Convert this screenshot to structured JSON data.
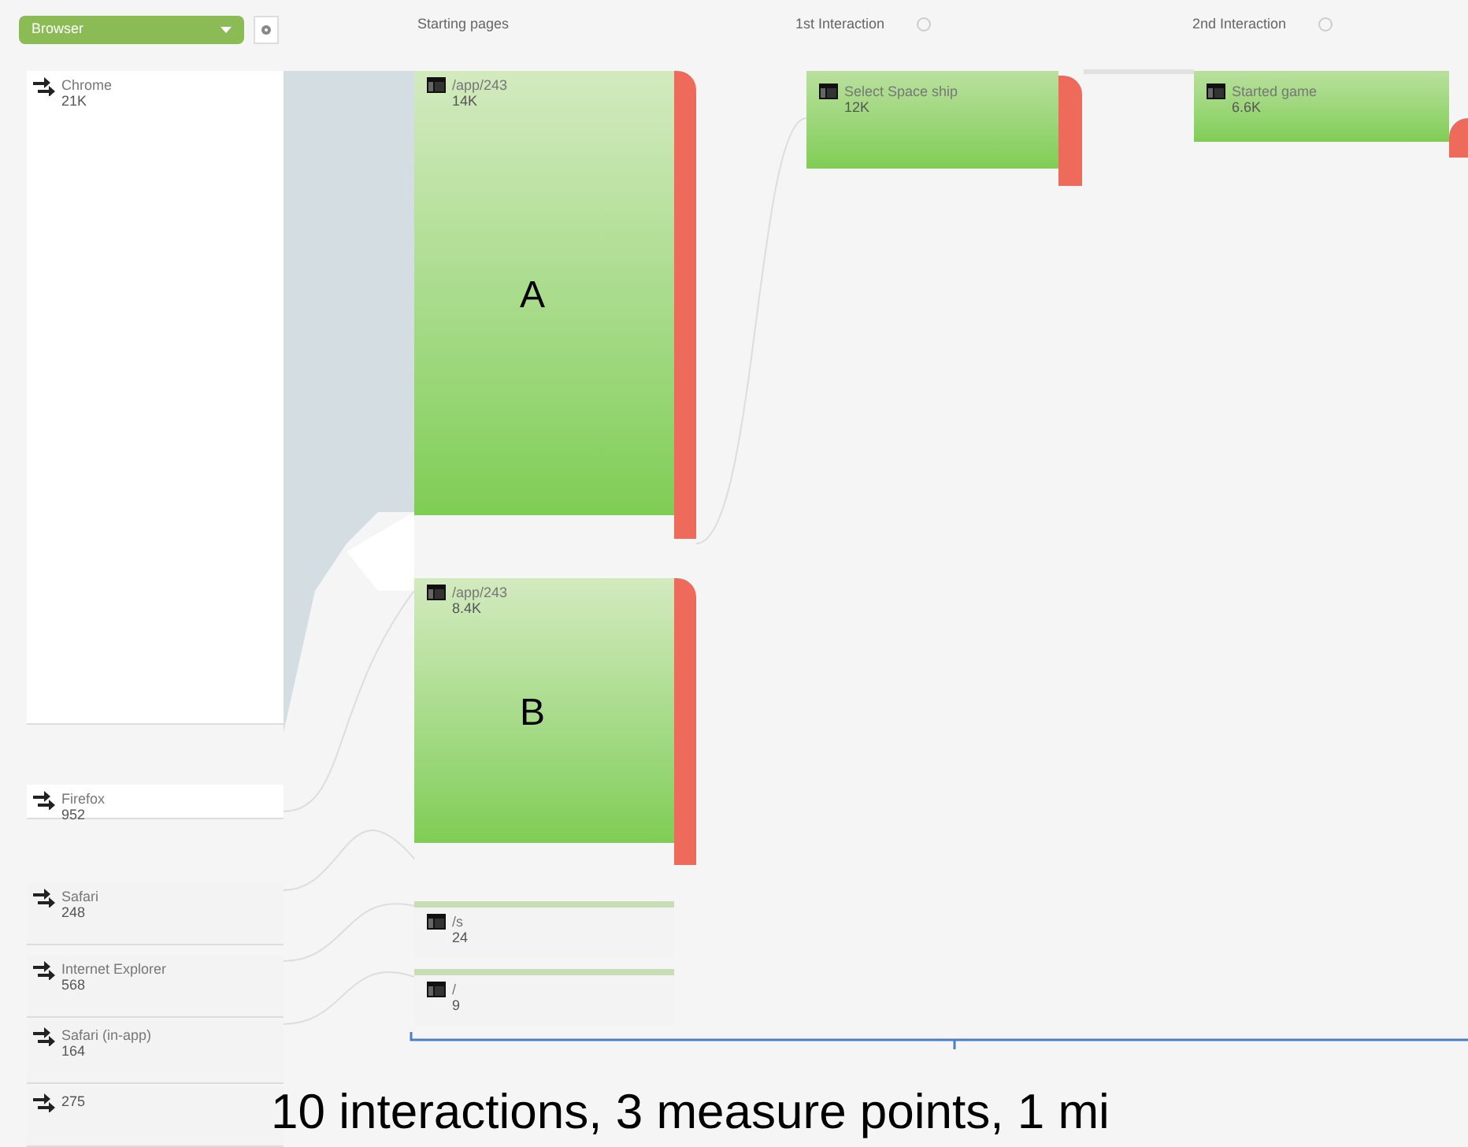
{
  "dimension_selector": {
    "value": "Browser"
  },
  "columns": [
    {
      "title": "Starting pages",
      "help": false
    },
    {
      "title": "1st Interaction",
      "help": true
    },
    {
      "title": "2nd Interaction",
      "help": true
    }
  ],
  "sources": [
    {
      "name": "Chrome",
      "count": "21K"
    },
    {
      "name": "Firefox",
      "count": "952"
    },
    {
      "name": "Safari",
      "count": "248"
    },
    {
      "name": "Internet Explorer",
      "count": "568"
    },
    {
      "name": "Safari (in-app)",
      "count": "164"
    },
    {
      "count": "275"
    }
  ],
  "starting_pages": [
    {
      "name": "/app/243",
      "count": "14K",
      "label": "A"
    },
    {
      "name": "/app/243",
      "count": "8.4K",
      "label": "B"
    },
    {
      "name": "/s",
      "count": "24"
    },
    {
      "name": "/",
      "count": "9"
    }
  ],
  "first_interaction": [
    {
      "name": "Select Space ship",
      "count": "12K"
    }
  ],
  "second_interaction": [
    {
      "name": "Started game",
      "count": "6.6K"
    }
  ],
  "annotation": "10 interactions, 3 measure points, 1 mi"
}
